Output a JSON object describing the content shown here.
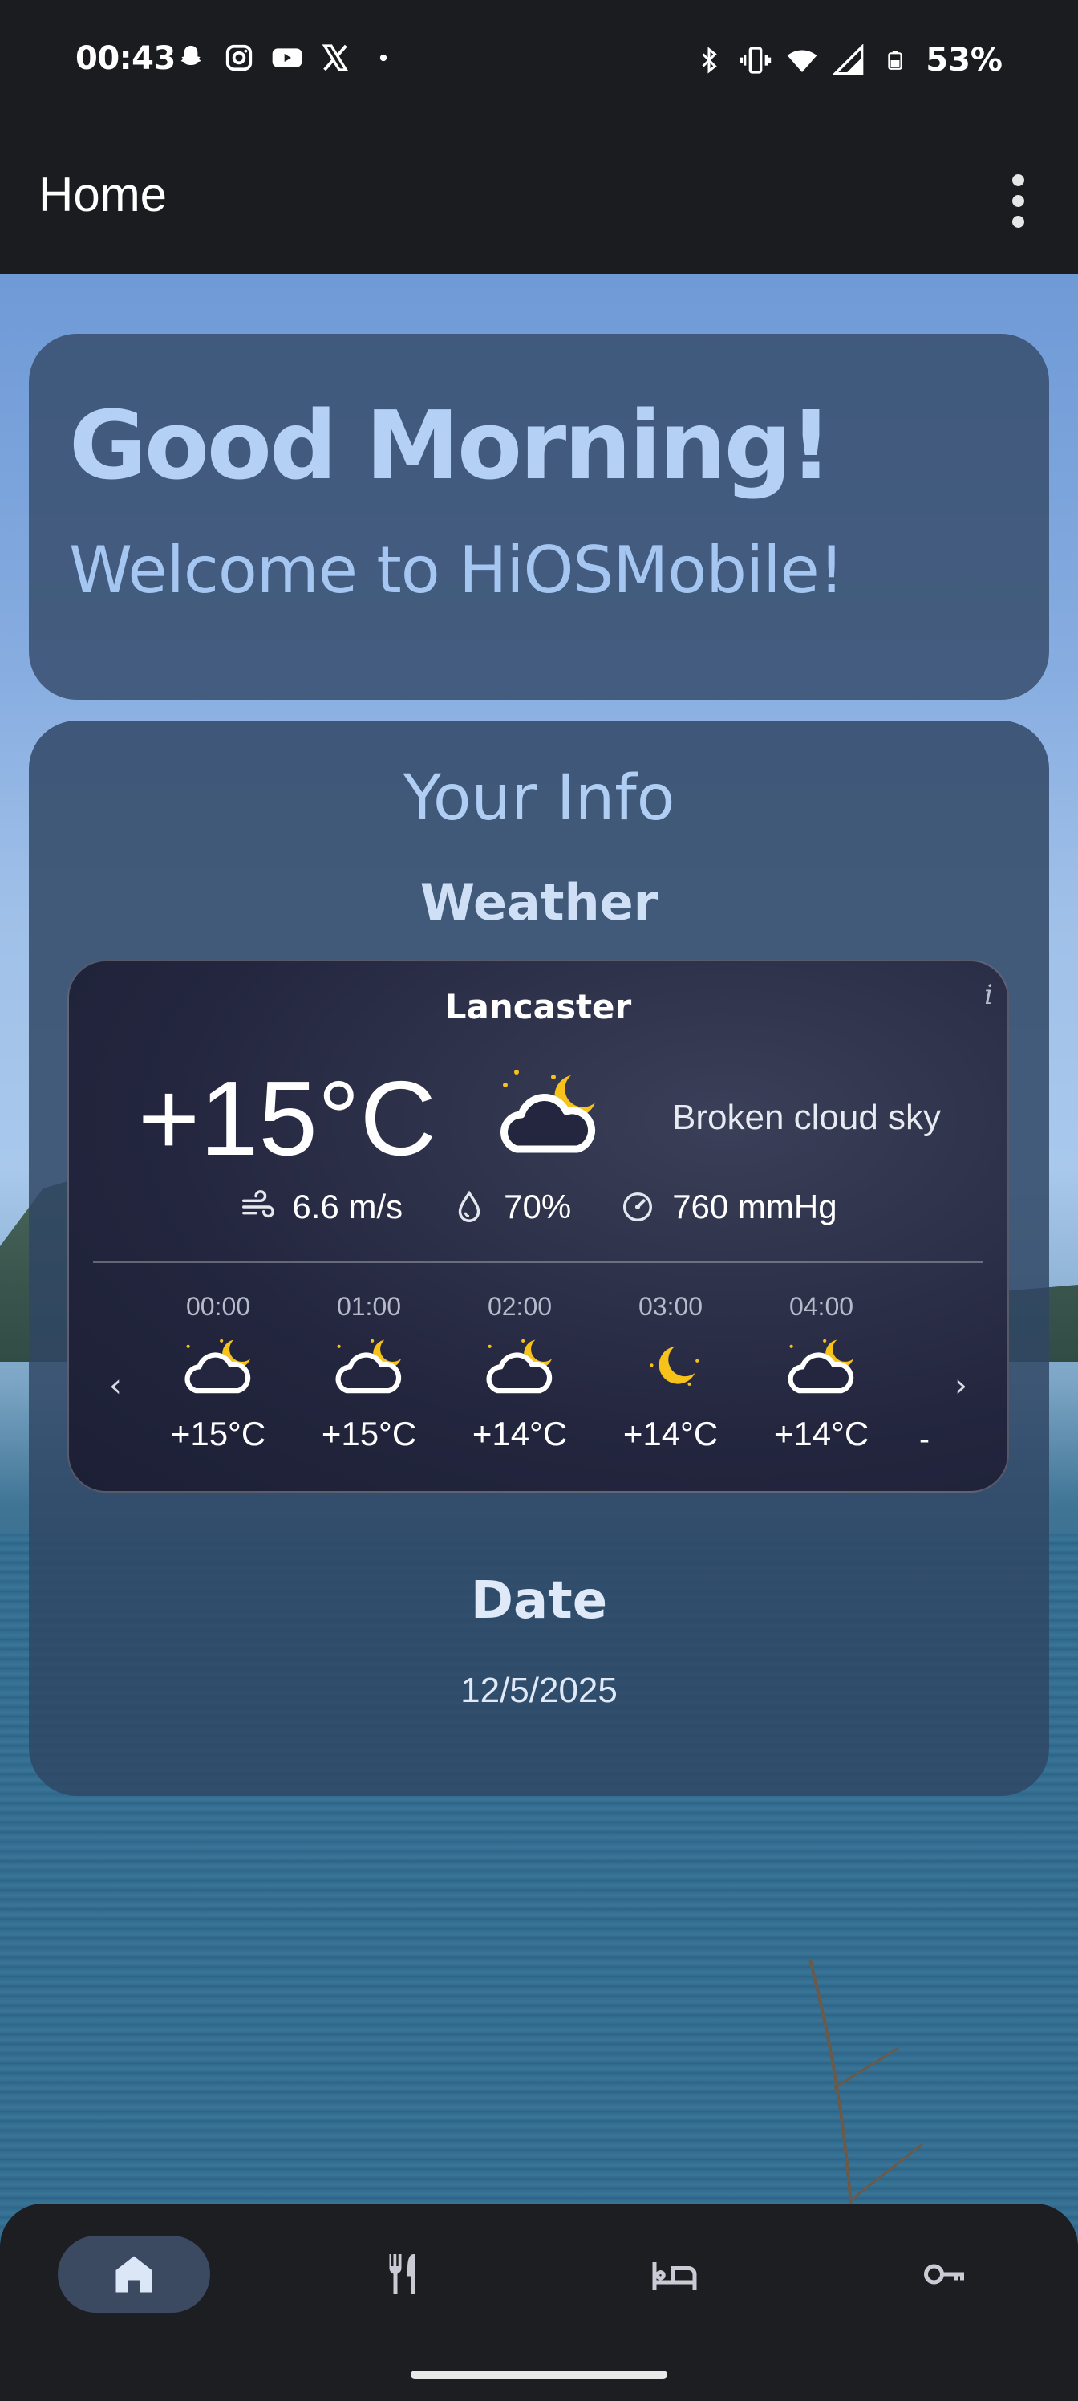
{
  "status_bar": {
    "time": "00:43",
    "battery": "53%",
    "left_icons": [
      "snapchat-icon",
      "instagram-icon",
      "youtube-icon",
      "x-icon",
      "dot-icon"
    ],
    "right_icons": [
      "bluetooth-icon",
      "vibrate-icon",
      "wifi-icon",
      "signal-icon",
      "battery-icon"
    ]
  },
  "app_bar": {
    "title": "Home"
  },
  "greeting": {
    "title": "Good Morning!",
    "subtitle": "Welcome to HiOSMobile!"
  },
  "info": {
    "title": "Your Info",
    "weather_heading": "Weather",
    "weather": {
      "city": "Lancaster",
      "info_icon": "i",
      "temperature": "+15°C",
      "description": "Broken cloud sky",
      "wind": "6.6 m/s",
      "humidity": "70%",
      "pressure": "760 mmHg",
      "prev_arrow": "‹",
      "next_arrow": "›",
      "trailing": "-",
      "hourly": [
        {
          "time": "00:00",
          "temp": "+15°C",
          "icon": "cloud-moon-icon"
        },
        {
          "time": "01:00",
          "temp": "+15°C",
          "icon": "cloud-moon-icon"
        },
        {
          "time": "02:00",
          "temp": "+14°C",
          "icon": "cloud-moon-icon"
        },
        {
          "time": "03:00",
          "temp": "+14°C",
          "icon": "moon-icon"
        },
        {
          "time": "04:00",
          "temp": "+14°C",
          "icon": "cloud-moon-icon"
        }
      ]
    },
    "date_heading": "Date",
    "date_value": "12/5/2025"
  },
  "bottom_nav": {
    "items": [
      {
        "name": "home",
        "icon": "home-icon",
        "active": true
      },
      {
        "name": "dining",
        "icon": "fork-knife-icon",
        "active": false
      },
      {
        "name": "rooms",
        "icon": "bed-icon",
        "active": false
      },
      {
        "name": "access",
        "icon": "key-icon",
        "active": false
      }
    ]
  },
  "colors": {
    "bar_bg": "#1b1c1f",
    "card_bg": "#344a69",
    "accent_text": "#b5d0f5",
    "sun_yellow": "#f7c21a",
    "nav_active": "#3b4a60"
  }
}
